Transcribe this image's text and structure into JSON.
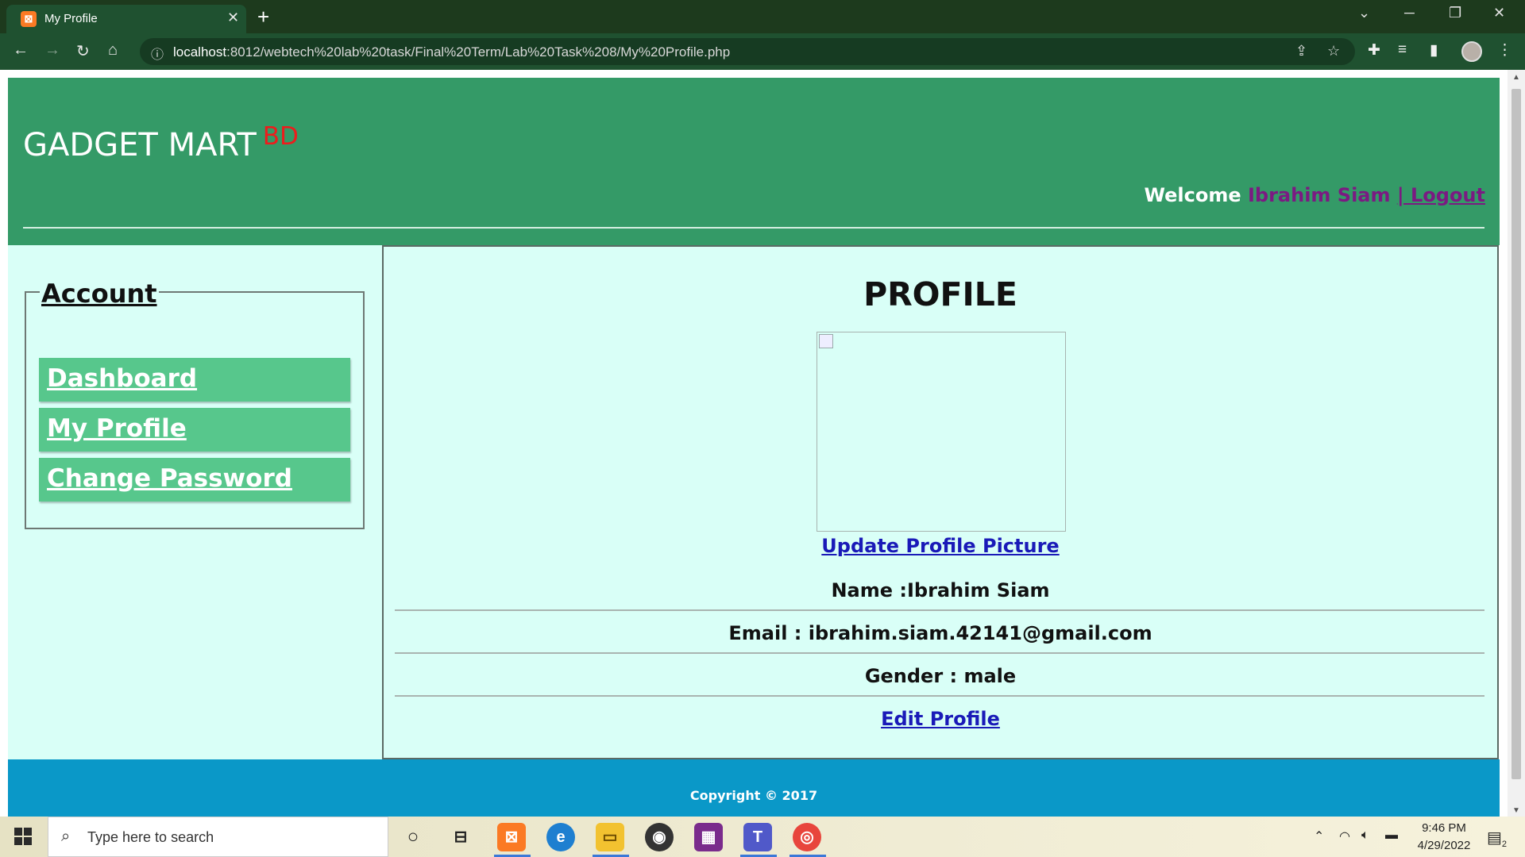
{
  "browser": {
    "tab_title": "My Profile",
    "tab_favicon": "xampp-icon",
    "url_host": "localhost",
    "url_rest": ":8012/webtech%20lab%20task/Final%20Term/Lab%20Task%208/My%20Profile.php"
  },
  "header": {
    "brand": "GADGET MART",
    "brand_suffix": "BD",
    "welcome_label": "Welcome",
    "user_name": "Ibrahim Siam",
    "logout_label": "| Logout"
  },
  "sidebar": {
    "legend": "Account",
    "items": [
      {
        "label": "Dashboard"
      },
      {
        "label": "My Profile"
      },
      {
        "label": "Change Password"
      }
    ]
  },
  "profile": {
    "title": "PROFILE",
    "update_picture_label": "Update Profile Picture",
    "name_line": "Name :Ibrahim Siam",
    "email_line": "Email : ibrahim.siam.42141@gmail.com",
    "gender_line": "Gender : male",
    "edit_label": "Edit Profile"
  },
  "footer": {
    "copyright": "Copyright © 2017"
  },
  "taskbar": {
    "search_placeholder": "Type here to search",
    "time": "9:46 PM",
    "date": "4/29/2022",
    "notification_count": "2"
  },
  "colors": {
    "header_bg": "#349a67",
    "content_bg": "#d9fff7",
    "menu_btn_bg": "#57c78c",
    "footer_bg": "#0a98c8",
    "brand_suffix": "#ee1c1c",
    "username": "#7b1a82"
  }
}
